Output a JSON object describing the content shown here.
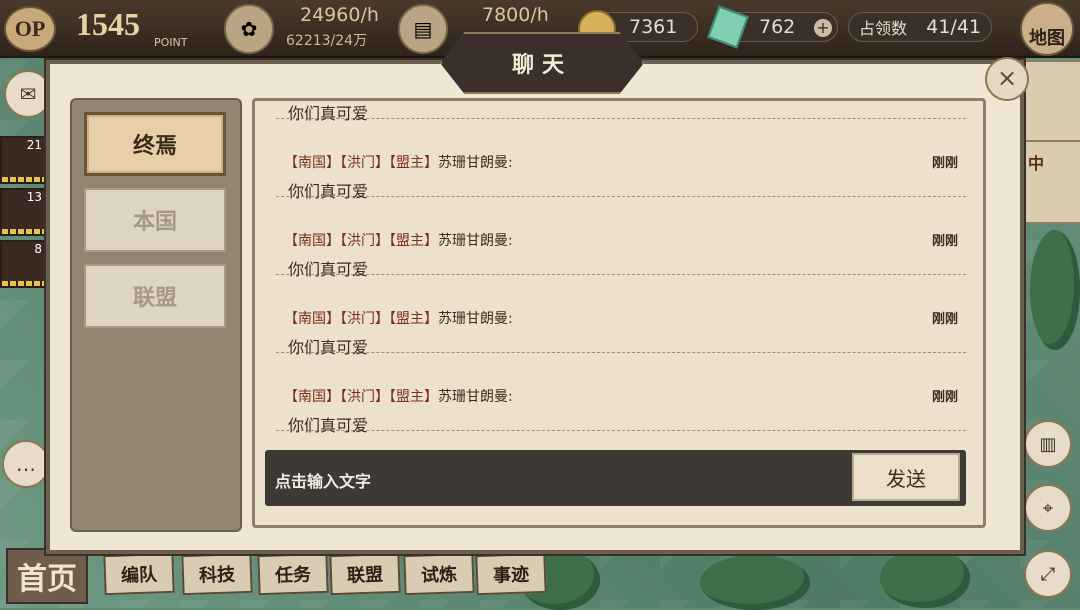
{
  "topbar": {
    "op_badge": "OP",
    "op_value": "1545",
    "op_label": "POINT",
    "resource1": {
      "rate": "24960/h",
      "cap": "62213/24万",
      "icon": "lotus-icon"
    },
    "resource2": {
      "rate": "7800/h",
      "icon": "scroll-icon"
    },
    "coins": "7361",
    "gems": "762",
    "territory_label": "占领数",
    "territory_value": "41/41",
    "map_label": "地图"
  },
  "side": {
    "heroes": [
      {
        "level": "21"
      },
      {
        "level": "13"
      },
      {
        "level": "8"
      }
    ],
    "right_label": "中"
  },
  "bottom_nav": {
    "home": "首页",
    "tabs": [
      "编队",
      "科技",
      "任务",
      "联盟",
      "试炼",
      "事迹"
    ]
  },
  "dialog": {
    "title": "聊天",
    "tabs": [
      {
        "label": "终焉",
        "active": true
      },
      {
        "label": "本国",
        "active": false
      },
      {
        "label": "联盟",
        "active": false
      }
    ],
    "messages": [
      {
        "tags": "【南国】【洪门】【盟主】",
        "name": "苏珊甘朗曼:",
        "time": "刚刚",
        "text": "你们真可爱"
      },
      {
        "tags": "【南国】【洪门】【盟主】",
        "name": "苏珊甘朗曼:",
        "time": "刚刚",
        "text": "你们真可爱"
      },
      {
        "tags": "【南国】【洪门】【盟主】",
        "name": "苏珊甘朗曼:",
        "time": "刚刚",
        "text": "你们真可爱"
      },
      {
        "tags": "【南国】【洪门】【盟主】",
        "name": "苏珊甘朗曼:",
        "time": "刚刚",
        "text": "你们真可爱"
      }
    ],
    "input_placeholder": "点击输入文字",
    "send_label": "发送"
  },
  "colors": {
    "accent_red": "#7b2f1c",
    "panel_bg": "#ece1cd",
    "topbar": "#2e241b"
  }
}
